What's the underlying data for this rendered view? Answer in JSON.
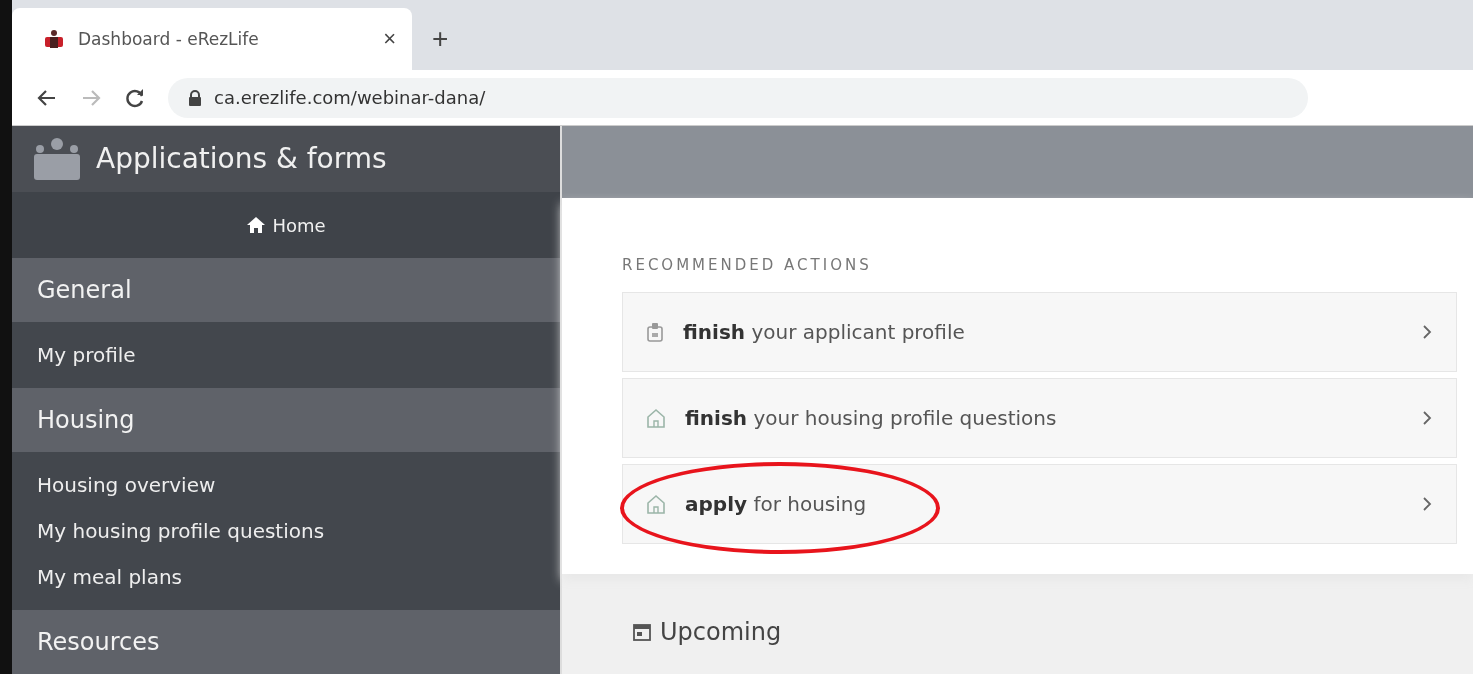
{
  "browser": {
    "tab_title": "Dashboard - eRezLife",
    "close": "×",
    "new_tab": "+",
    "url": "ca.erezlife.com/webinar-dana/"
  },
  "sidebar": {
    "title": "Applications & forms",
    "home": "Home",
    "sections": [
      {
        "title": "General",
        "items": [
          "My profile"
        ]
      },
      {
        "title": "Housing",
        "items": [
          "Housing overview",
          "My housing profile questions",
          "My meal plans"
        ]
      },
      {
        "title": "Resources"
      }
    ]
  },
  "main": {
    "heading": "RECOMMENDED ACTIONS",
    "actions": [
      {
        "kind": "profile",
        "text": "**finish** your applicant profile",
        "highlighted": false
      },
      {
        "kind": "housing",
        "text": "**finish** your housing profile questions",
        "highlighted": false
      },
      {
        "kind": "housing",
        "text": "**apply** for housing",
        "highlighted": true
      }
    ],
    "upcoming": "Upcoming"
  }
}
